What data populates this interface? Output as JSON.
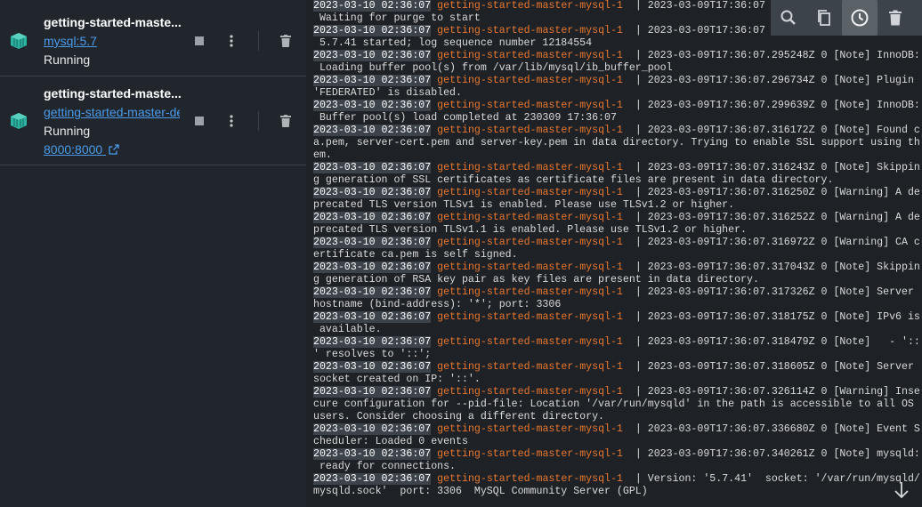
{
  "containers": [
    {
      "name": "getting-started-maste...",
      "image": "mysql:5.7",
      "status": "Running",
      "port": ""
    },
    {
      "name": "getting-started-maste...",
      "image": "getting-started-master-de",
      "status": "Running",
      "port": "8000:8000"
    }
  ],
  "toolbar": {
    "items": [
      "search-icon",
      "copy-icon",
      "clock-icon",
      "delete-icon"
    ],
    "active": "clock-icon"
  },
  "log_lines": [
    {
      "ts": "2023-03-10 02:36:07",
      "src": "getting-started-master-mysql-1",
      "msg": "  | 2023-03-09T17:36:07"
    },
    {
      "ts": "",
      "src": "",
      "msg": " Waiting for purge to start"
    },
    {
      "ts": "2023-03-10 02:36:07",
      "src": "getting-started-master-mysql-1",
      "msg": "  | 2023-03-09T17:36:07"
    },
    {
      "ts": "",
      "src": "",
      "msg": " 5.7.41 started; log sequence number 12184554"
    },
    {
      "ts": "2023-03-10 02:36:07",
      "src": "getting-started-master-mysql-1",
      "msg": "  | 2023-03-09T17:36:07.295248Z 0 [Note] InnoDB:"
    },
    {
      "ts": "",
      "src": "",
      "msg": " Loading buffer pool(s) from /var/lib/mysql/ib_buffer_pool"
    },
    {
      "ts": "2023-03-10 02:36:07",
      "src": "getting-started-master-mysql-1",
      "msg": "  | 2023-03-09T17:36:07.296734Z 0 [Note] Plugin"
    },
    {
      "ts": "",
      "src": "",
      "msg": "'FEDERATED' is disabled."
    },
    {
      "ts": "2023-03-10 02:36:07",
      "src": "getting-started-master-mysql-1",
      "msg": "  | 2023-03-09T17:36:07.299639Z 0 [Note] InnoDB:"
    },
    {
      "ts": "",
      "src": "",
      "msg": " Buffer pool(s) load completed at 230309 17:36:07"
    },
    {
      "ts": "2023-03-10 02:36:07",
      "src": "getting-started-master-mysql-1",
      "msg": "  | 2023-03-09T17:36:07.316172Z 0 [Note] Found c"
    },
    {
      "ts": "",
      "src": "",
      "msg": "a.pem, server-cert.pem and server-key.pem in data directory. Trying to enable SSL support using th"
    },
    {
      "ts": "",
      "src": "",
      "msg": "em."
    },
    {
      "ts": "2023-03-10 02:36:07",
      "src": "getting-started-master-mysql-1",
      "msg": "  | 2023-03-09T17:36:07.316243Z 0 [Note] Skippin"
    },
    {
      "ts": "",
      "src": "",
      "msg": "g generation of SSL certificates as certificate files are present in data directory."
    },
    {
      "ts": "2023-03-10 02:36:07",
      "src": "getting-started-master-mysql-1",
      "msg": "  | 2023-03-09T17:36:07.316250Z 0 [Warning] A de"
    },
    {
      "ts": "",
      "src": "",
      "msg": "precated TLS version TLSv1 is enabled. Please use TLSv1.2 or higher."
    },
    {
      "ts": "2023-03-10 02:36:07",
      "src": "getting-started-master-mysql-1",
      "msg": "  | 2023-03-09T17:36:07.316252Z 0 [Warning] A de"
    },
    {
      "ts": "",
      "src": "",
      "msg": "precated TLS version TLSv1.1 is enabled. Please use TLSv1.2 or higher."
    },
    {
      "ts": "2023-03-10 02:36:07",
      "src": "getting-started-master-mysql-1",
      "msg": "  | 2023-03-09T17:36:07.316972Z 0 [Warning] CA c"
    },
    {
      "ts": "",
      "src": "",
      "msg": "ertificate ca.pem is self signed."
    },
    {
      "ts": "2023-03-10 02:36:07",
      "src": "getting-started-master-mysql-1",
      "msg": "  | 2023-03-09T17:36:07.317043Z 0 [Note] Skippin"
    },
    {
      "ts": "",
      "src": "",
      "msg": "g generation of RSA key pair as key files are present in data directory."
    },
    {
      "ts": "2023-03-10 02:36:07",
      "src": "getting-started-master-mysql-1",
      "msg": "  | 2023-03-09T17:36:07.317326Z 0 [Note] Server"
    },
    {
      "ts": "",
      "src": "",
      "msg": "hostname (bind-address): '*'; port: 3306"
    },
    {
      "ts": "2023-03-10 02:36:07",
      "src": "getting-started-master-mysql-1",
      "msg": "  | 2023-03-09T17:36:07.318175Z 0 [Note] IPv6 is"
    },
    {
      "ts": "",
      "src": "",
      "msg": " available."
    },
    {
      "ts": "2023-03-10 02:36:07",
      "src": "getting-started-master-mysql-1",
      "msg": "  | 2023-03-09T17:36:07.318479Z 0 [Note]   - '::"
    },
    {
      "ts": "",
      "src": "",
      "msg": "' resolves to '::';"
    },
    {
      "ts": "2023-03-10 02:36:07",
      "src": "getting-started-master-mysql-1",
      "msg": "  | 2023-03-09T17:36:07.318605Z 0 [Note] Server"
    },
    {
      "ts": "",
      "src": "",
      "msg": "socket created on IP: '::'."
    },
    {
      "ts": "2023-03-10 02:36:07",
      "src": "getting-started-master-mysql-1",
      "msg": "  | 2023-03-09T17:36:07.326114Z 0 [Warning] Inse"
    },
    {
      "ts": "",
      "src": "",
      "msg": "cure configuration for --pid-file: Location '/var/run/mysqld' in the path is accessible to all OS"
    },
    {
      "ts": "",
      "src": "",
      "msg": "users. Consider choosing a different directory."
    },
    {
      "ts": "2023-03-10 02:36:07",
      "src": "getting-started-master-mysql-1",
      "msg": "  | 2023-03-09T17:36:07.336680Z 0 [Note] Event S"
    },
    {
      "ts": "",
      "src": "",
      "msg": "cheduler: Loaded 0 events"
    },
    {
      "ts": "2023-03-10 02:36:07",
      "src": "getting-started-master-mysql-1",
      "msg": "  | 2023-03-09T17:36:07.340261Z 0 [Note] mysqld:"
    },
    {
      "ts": "",
      "src": "",
      "msg": " ready for connections."
    },
    {
      "ts": "2023-03-10 02:36:07",
      "src": "getting-started-master-mysql-1",
      "msg": "  | Version: '5.7.41'  socket: '/var/run/mysqld/"
    },
    {
      "ts": "",
      "src": "",
      "msg": "mysqld.sock'  port: 3306  MySQL Community Server (GPL)"
    }
  ]
}
